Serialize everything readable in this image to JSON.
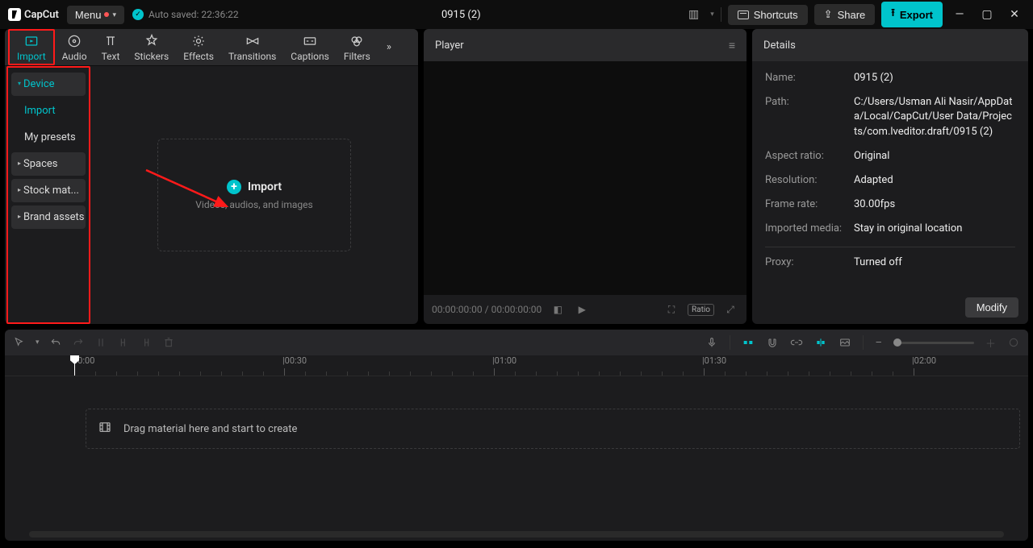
{
  "app": {
    "name": "CapCut"
  },
  "titlebar": {
    "menu_label": "Menu",
    "autosave_label": "Auto saved: 22:36:22",
    "project_title": "0915 (2)",
    "shortcuts_label": "Shortcuts",
    "share_label": "Share",
    "export_label": "Export"
  },
  "media_tabs": {
    "import": "Import",
    "audio": "Audio",
    "text": "Text",
    "stickers": "Stickers",
    "effects": "Effects",
    "transitions": "Transitions",
    "captions": "Captions",
    "filters": "Filters"
  },
  "sidebar": {
    "device": "Device",
    "import": "Import",
    "my_presets": "My presets",
    "spaces": "Spaces",
    "stock": "Stock mat...",
    "brand": "Brand assets"
  },
  "dropzone": {
    "title": "Import",
    "subtitle": "Videos, audios, and images"
  },
  "player": {
    "header": "Player",
    "time": "00:00:00:00 / 00:00:00:00",
    "ratio_label": "Ratio"
  },
  "details": {
    "header": "Details",
    "name_label": "Name:",
    "name_value": "0915 (2)",
    "path_label": "Path:",
    "path_value": "C:/Users/Usman Ali Nasir/AppData/Local/CapCut/User Data/Projects/com.lveditor.draft/0915 (2)",
    "aspect_label": "Aspect ratio:",
    "aspect_value": "Original",
    "resolution_label": "Resolution:",
    "resolution_value": "Adapted",
    "framerate_label": "Frame rate:",
    "framerate_value": "30.00fps",
    "imported_label": "Imported media:",
    "imported_value": "Stay in original location",
    "proxy_label": "Proxy:",
    "proxy_value": "Turned off",
    "modify_label": "Modify"
  },
  "timeline": {
    "ruler_marks": [
      "00:00",
      "|00:30",
      "|01:00",
      "|01:30",
      "|02:00"
    ],
    "drop_hint": "Drag material here and start to create"
  }
}
